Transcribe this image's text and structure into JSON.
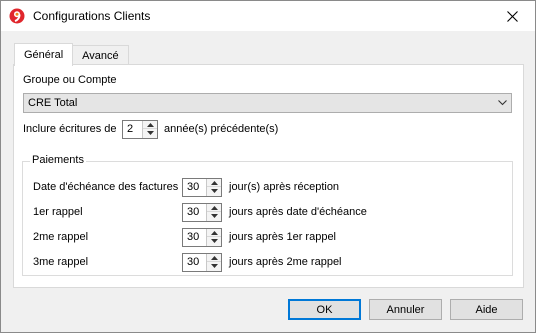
{
  "window": {
    "title": "Configurations Clients"
  },
  "tabs": [
    {
      "label": "Général",
      "active": true
    },
    {
      "label": "Avancé",
      "active": false
    }
  ],
  "general": {
    "group_label": "Groupe ou Compte",
    "group_value": "CRE Total",
    "include_prefix": "Inclure écritures de",
    "include_value": "2",
    "include_suffix": "année(s) précédente(s)"
  },
  "payments": {
    "title": "Paiements",
    "rows": [
      {
        "label": "Date d'échéance des factures",
        "value": "30",
        "suffix": "jour(s) après réception"
      },
      {
        "label": "1er rappel",
        "value": "30",
        "suffix": "jours après date d'échéance"
      },
      {
        "label": "2me rappel",
        "value": "30",
        "suffix": "jours après 1er rappel"
      },
      {
        "label": "3me rappel",
        "value": "30",
        "suffix": "jours après 2me rappel"
      }
    ]
  },
  "buttons": {
    "ok": "OK",
    "cancel": "Annuler",
    "help": "Aide"
  },
  "colors": {
    "accent": "#0078d7",
    "logo_red": "#e0262c",
    "logo_orange": "#f08a1c"
  },
  "icons": {
    "app": "banana-logo-icon",
    "close": "close-icon",
    "dropdown": "chevron-down-icon",
    "spin_up": "arrow-up-icon",
    "spin_down": "arrow-down-icon"
  }
}
